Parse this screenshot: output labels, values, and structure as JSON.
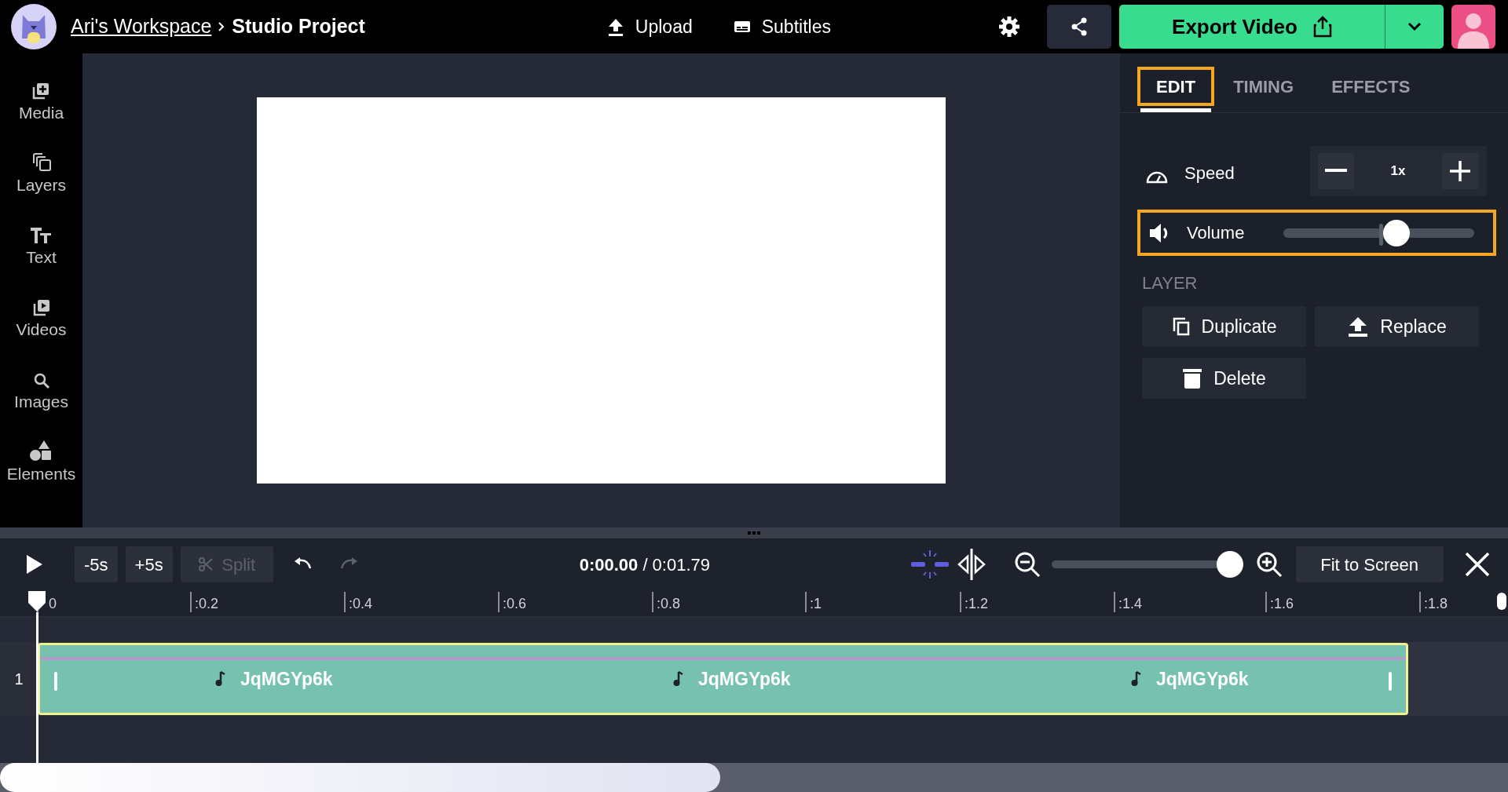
{
  "header": {
    "breadcrumb": [
      {
        "label": "Ari's Workspace",
        "kind": "link"
      },
      {
        "label": "Studio Project",
        "kind": "current"
      }
    ],
    "actions": [
      {
        "label": "Upload",
        "kind": "upload"
      },
      {
        "label": "Subtitles",
        "kind": "subtitles"
      }
    ],
    "export_button": "Export Video"
  },
  "sidebar": {
    "items": [
      {
        "label": "Media",
        "kind": "media"
      },
      {
        "label": "Layers",
        "kind": "layers"
      },
      {
        "label": "Text",
        "kind": "text"
      },
      {
        "label": "Videos",
        "kind": "videos"
      },
      {
        "label": "Images",
        "kind": "images"
      },
      {
        "label": "Elements",
        "kind": "elements"
      }
    ]
  },
  "right_panel": {
    "tabs": [
      {
        "label": "EDIT",
        "selected": true,
        "highlighted": true
      },
      {
        "label": "TIMING",
        "selected": false,
        "highlighted": false
      },
      {
        "label": "EFFECTS",
        "selected": false,
        "highlighted": false
      }
    ],
    "speed": {
      "label": "Speed",
      "value": "1x"
    },
    "volume": {
      "label": "Volume",
      "level": 0.59,
      "highlighted": true
    },
    "section_title": "LAYER",
    "buttons": [
      {
        "label": "Duplicate",
        "kind": "duplicate"
      },
      {
        "label": "Replace",
        "kind": "replace"
      },
      {
        "label": "Delete",
        "kind": "delete"
      }
    ]
  },
  "timeline": {
    "skip_buttons": [
      "-5s",
      "+5s"
    ],
    "split": {
      "label": "Split",
      "disabled": true
    },
    "redo_disabled": true,
    "time": "**0:00.00** / 0:01.79",
    "zoom": {
      "level": 0.93
    },
    "fit_button": "Fit to Screen",
    "ruler": [
      "0",
      ":0.2",
      ":0.4",
      ":0.6",
      ":0.8",
      ":1",
      ":1.2",
      ":1.4",
      ":1.6",
      ":1.8"
    ],
    "tracks": [
      {
        "number": "1",
        "clips": [
          "JqMGYp6k",
          "JqMGYp6k",
          "JqMGYp6k"
        ]
      }
    ]
  }
}
